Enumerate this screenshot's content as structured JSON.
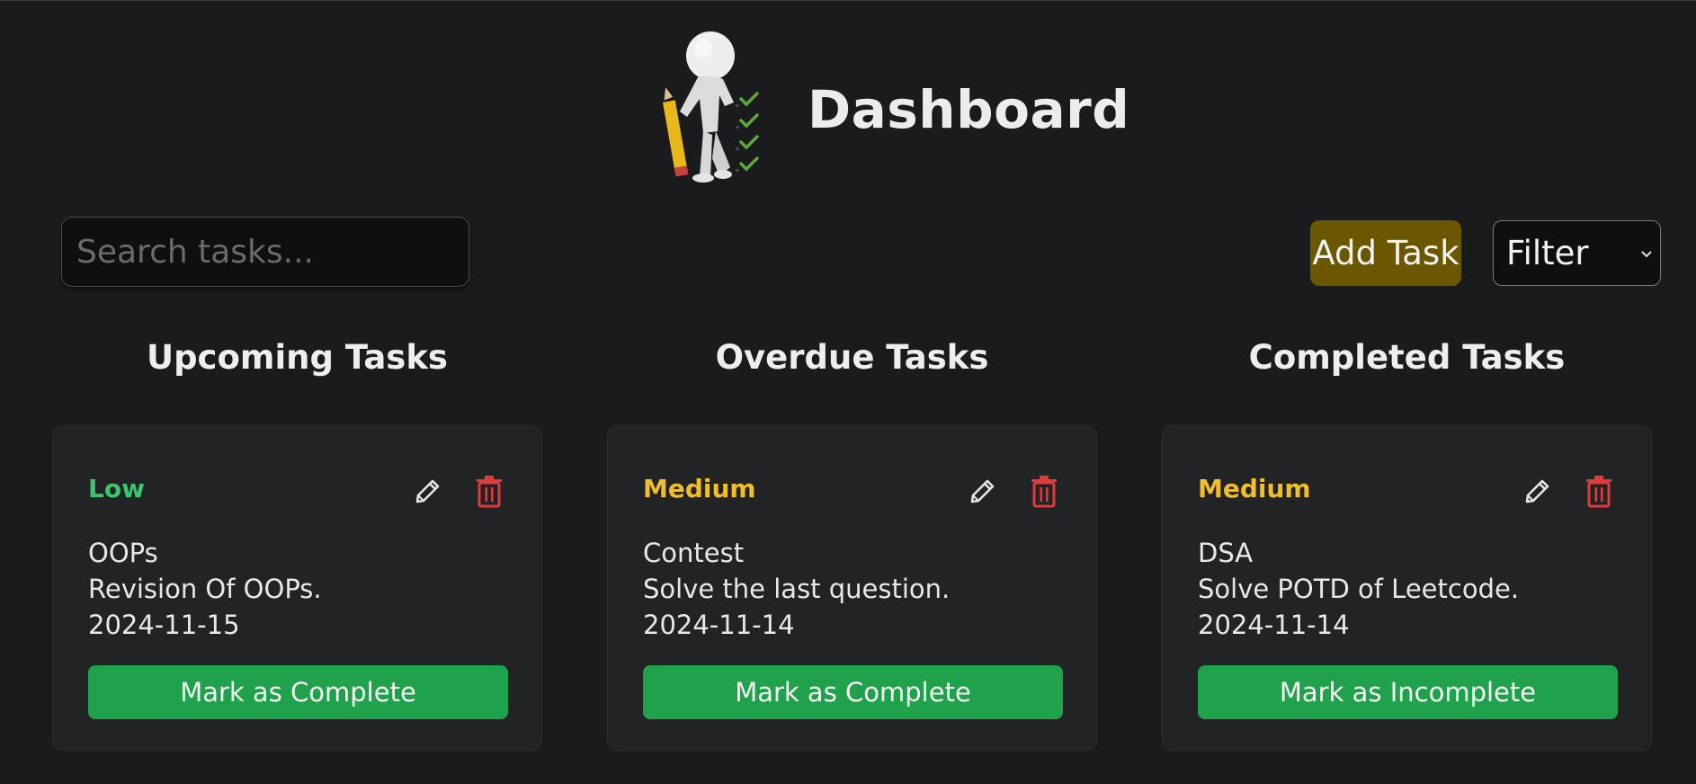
{
  "header": {
    "title": "Dashboard",
    "logo_icon": "person-with-pencil-checklist-icon"
  },
  "toolbar": {
    "search_placeholder": "Search tasks...",
    "search_value": "",
    "add_task_label": "Add Task",
    "filter_label": "Filter",
    "colors": {
      "add_task_bg": "#6b5700"
    }
  },
  "columns": [
    {
      "title": "Upcoming Tasks",
      "task": {
        "priority": "Low",
        "priority_color": "#3ec46d",
        "name": "OOPs",
        "description": "Revision Of OOPs.",
        "date": "2024-11-15",
        "action_label": "Mark as Complete"
      }
    },
    {
      "title": "Overdue Tasks",
      "task": {
        "priority": "Medium",
        "priority_color": "#f0be2c",
        "name": "Contest",
        "description": "Solve the last question.",
        "date": "2024-11-14",
        "action_label": "Mark as Complete"
      }
    },
    {
      "title": "Completed Tasks",
      "task": {
        "priority": "Medium",
        "priority_color": "#f0be2c",
        "name": "DSA",
        "description": "Solve POTD of Leetcode.",
        "date": "2024-11-14",
        "action_label": "Mark as Incomplete"
      }
    }
  ],
  "icons": {
    "edit": "pencil-icon",
    "delete": "trash-icon",
    "filter_dropdown": "chevron-down-icon"
  },
  "colors": {
    "background": "#1a1b1d",
    "card": "#222325",
    "action_button": "#1fa24b",
    "delete_icon": "#e03a3a"
  }
}
